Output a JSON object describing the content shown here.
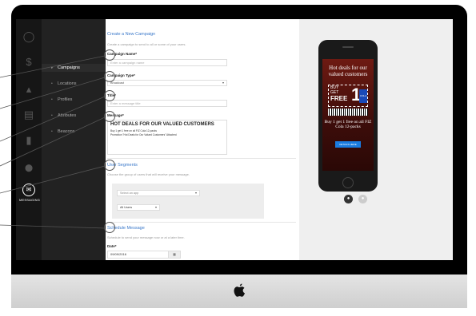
{
  "sidebar_rail": {
    "items": [
      {
        "icon": "logo-icon",
        "glyph": "◯"
      },
      {
        "icon": "dollar-icon",
        "glyph": "$"
      },
      {
        "icon": "chart-icon",
        "glyph": "▴"
      },
      {
        "icon": "document-icon",
        "glyph": "▤"
      },
      {
        "icon": "briefcase-icon",
        "glyph": "▮"
      },
      {
        "icon": "location-pin-icon",
        "glyph": "⬤"
      }
    ],
    "active": {
      "icon": "messaging-icon",
      "glyph": "✉",
      "label": "MESSAGING"
    }
  },
  "nav": {
    "items": [
      {
        "label": "Campaigns",
        "icon": "megaphone-icon",
        "glyph": "▸"
      },
      {
        "label": "Locations",
        "icon": "location-icon",
        "glyph": "•"
      },
      {
        "label": "Profiles",
        "icon": "user-icon",
        "glyph": "•"
      },
      {
        "label": "Attributes",
        "icon": "tag-icon",
        "glyph": "•"
      },
      {
        "label": "Beacons",
        "icon": "beacon-icon",
        "glyph": "•"
      }
    ]
  },
  "form": {
    "title": "Create a New Campaign",
    "subtitle": "Create a campaign to send to all or some of your users.",
    "campaign_name_label": "Campaign Name*",
    "campaign_name_placeholder": "Enter a campaign name",
    "campaign_type_label": "Campaign Type*",
    "campaign_type_value": "Broadcast",
    "title_label": "Title*",
    "title_placeholder": "Enter a message title",
    "message_label": "Message*",
    "message_title": "HOT DEALS FOR OUR VALUED CUSTOMERS",
    "message_line1": "Buy 1 get 1 free on all FIZ Cola 12-packs",
    "message_line2": "Promotion \"Hot Deals for Our Valued Customers\" Attached",
    "user_segments_title": "User Segments",
    "user_segments_desc": "Choose the group of users that will receive your message.",
    "select_app_placeholder": "Select an app",
    "all_users": "All Users",
    "schedule_title": "Schedule Message",
    "schedule_desc": "Schedule to send your message now or at a later time.",
    "date_label": "Date*",
    "date_value": "09/09/2016"
  },
  "preview": {
    "ad_headline": "Hot deals for our valued customers",
    "ad_buy": "BUY",
    "ad_get": "GET",
    "ad_free": "FREE",
    "ad_one": "1",
    "ad_brand": "COLA",
    "ad_description": "Buy 1 get 1 free on all FIZ Cola 12-packs",
    "ad_button": "DETAILS HERE"
  },
  "colors": {
    "accent_blue": "#3a78c9",
    "ad_red": "#6e1a12",
    "button_blue": "#1a7be0"
  }
}
